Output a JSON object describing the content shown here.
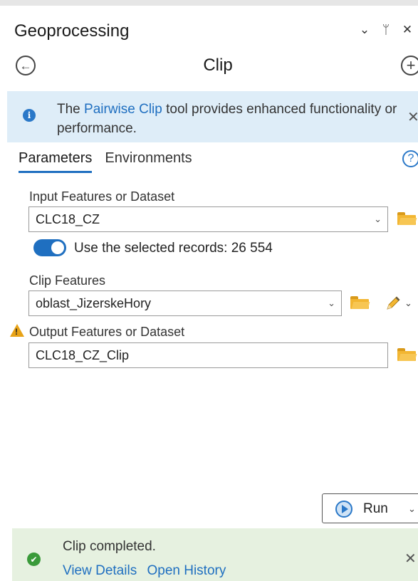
{
  "pane": {
    "title": "Geoprocessing",
    "controls": {
      "options": "⌄",
      "pin": "ᛘ",
      "close": "✕"
    }
  },
  "nav": {
    "back_icon": "back-arrow-icon",
    "tool_title": "Clip",
    "add_icon": "add-icon"
  },
  "info_banner": {
    "prefix": "The ",
    "link": "Pairwise Clip",
    "suffix": " tool provides enhanced functionality or performance.",
    "close": "✕"
  },
  "tabs": [
    {
      "label": "Parameters",
      "active": true
    },
    {
      "label": "Environments",
      "active": false
    }
  ],
  "help_icon": "?",
  "params": {
    "input": {
      "label": "Input Features or Dataset",
      "value": "CLC18_CZ",
      "use_selected": {
        "label": "Use the selected records: 26 554",
        "on": true
      }
    },
    "clip": {
      "label": "Clip Features",
      "value": "oblast_JizerskeHory"
    },
    "output": {
      "label": "Output Features or Dataset",
      "value": "CLC18_CZ_Clip",
      "warning_mark": "!"
    }
  },
  "dropdown_arrow": "⌄",
  "run": {
    "label": "Run",
    "caret": "⌄"
  },
  "status": {
    "icon": "✔",
    "message": "Clip completed.",
    "links": [
      "View Details",
      "Open History"
    ],
    "close": "✕"
  },
  "colors": {
    "accent": "#1f6fc0",
    "info_bg": "#deedf8",
    "success_bg": "#e6f1e0",
    "warning": "#e8a317",
    "folder": "#f2b632"
  }
}
